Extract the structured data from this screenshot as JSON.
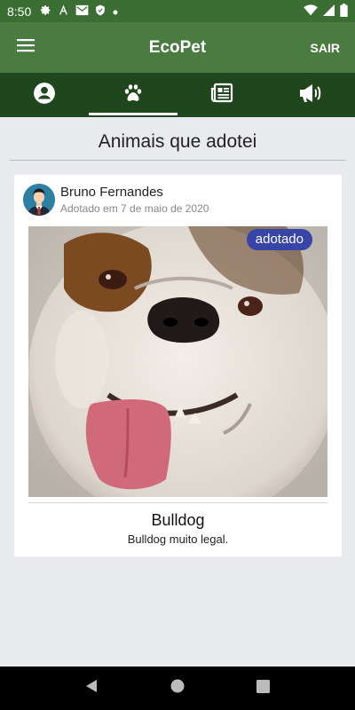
{
  "status_bar": {
    "time": "8:50",
    "left_icons": [
      "gear-icon",
      "android-studio-icon",
      "mail-icon",
      "shield-icon",
      "dot-icon"
    ],
    "right_icons": [
      "wifi-icon",
      "signal-icon",
      "battery-icon"
    ]
  },
  "app_bar": {
    "title": "EcoPet",
    "menu_icon": "menu-icon",
    "logout_label": "SAIR",
    "background": "#4a7b41"
  },
  "tabs": [
    {
      "icon": "account-icon",
      "active": false
    },
    {
      "icon": "paw-icon",
      "active": true
    },
    {
      "icon": "newspaper-icon",
      "active": false
    },
    {
      "icon": "megaphone-icon",
      "active": false
    }
  ],
  "page": {
    "heading": "Animais que adotei"
  },
  "cards": [
    {
      "user_name": "Bruno Fernandes",
      "adopted_date": "Adotado em 7 de maio de 2020",
      "badge": "adotado",
      "pet_name": "Bulldog",
      "pet_description": "Bulldog muito legal."
    }
  ],
  "colors": {
    "status_bar": "#3a6e33",
    "tab_bar": "#1f461c",
    "badge": "#3645a7",
    "page_background": "#e9eaed"
  },
  "nav_bar": {
    "buttons": [
      "back-icon",
      "home-icon",
      "recents-icon"
    ]
  }
}
